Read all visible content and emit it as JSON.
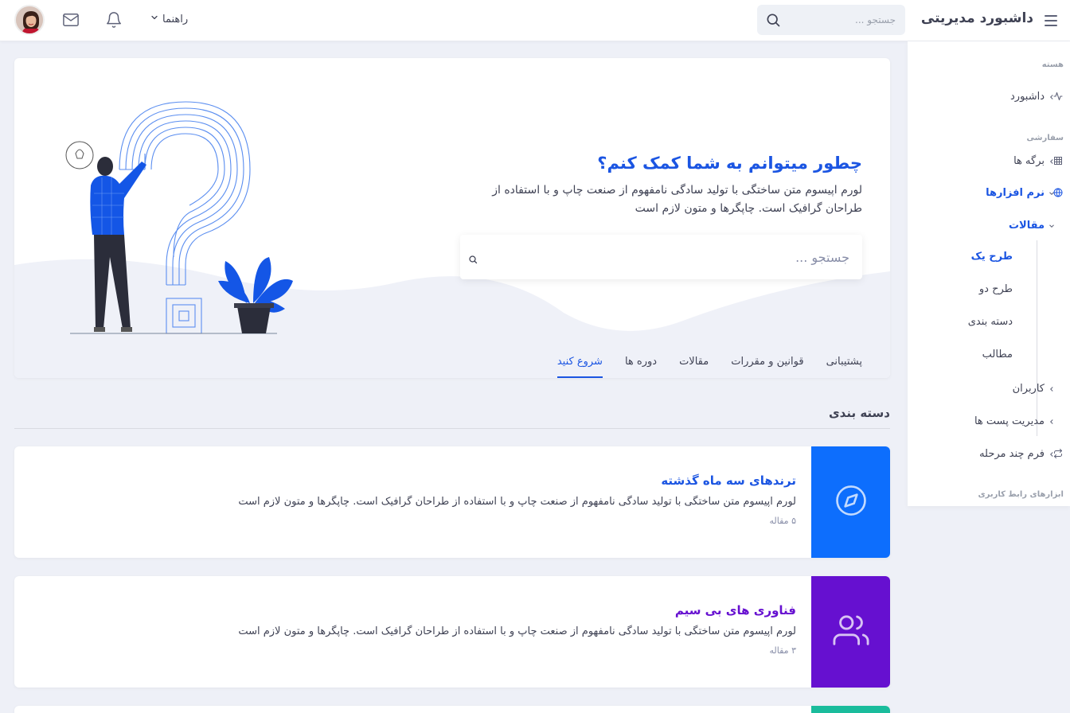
{
  "header": {
    "brand": "داشبورد مدیریتی",
    "search_placeholder": "جستجو ...",
    "guide_label": "راهنما"
  },
  "sidebar": {
    "section_core": "هسته",
    "section_custom": "سفارشی",
    "section_ui": "ابزارهای رابط کاربری",
    "items": [
      {
        "label": "داشبورد",
        "icon": "activity-icon"
      },
      {
        "label": "برگه ها",
        "icon": "grid-icon"
      },
      {
        "label": "نرم افزارها",
        "icon": "globe-icon"
      },
      {
        "label": "مقالات"
      },
      {
        "label": "کاربران"
      },
      {
        "label": "مدیریت پست ها"
      },
      {
        "label": "فرم چند مرحله",
        "icon": "repeat-icon"
      }
    ],
    "sub_items": [
      "طرح یک",
      "طرح دو",
      "دسته بندی",
      "مطالب"
    ]
  },
  "hero": {
    "title": "چطور میتوانم به شما کمک کنم؟",
    "description": "لورم اپیسوم متن ساختگی با تولید سادگی نامفهوم از صنعت چاپ و با استفاده از طراحان گرافیک است. چاپگرها و متون لازم است",
    "search_placeholder": "جستجو ...",
    "tabs": [
      "شروع کنید",
      "دوره ها",
      "مقالات",
      "قوانین و مقررات",
      "پشتیبانی"
    ]
  },
  "categories": {
    "title": "دسته بندی",
    "cards": [
      {
        "name": "ترندهای سه ماه گذشته",
        "description": "لورم اپیسوم متن ساختگی با تولید سادگی نامفهوم از صنعت چاپ و با استفاده از طراحان گرافیک است. چاپگرها و متون لازم است",
        "count": "۵ مقاله",
        "color": "#0d6efd",
        "icon": "compass-icon"
      },
      {
        "name": "فناوری های بی سیم",
        "description": "لورم اپیسوم متن ساختگی با تولید سادگی نامفهوم از صنعت چاپ و با استفاده از طراحان گرافیک است. چاپگرها و متون لازم است",
        "count": "۳ مقاله",
        "color": "#6610d0",
        "icon": "users-icon"
      }
    ]
  },
  "colors": {
    "primary": "#1b55e2",
    "card_blue": "#0d6efd",
    "card_purple": "#6610d0",
    "card_teal": "#1abc9c"
  }
}
